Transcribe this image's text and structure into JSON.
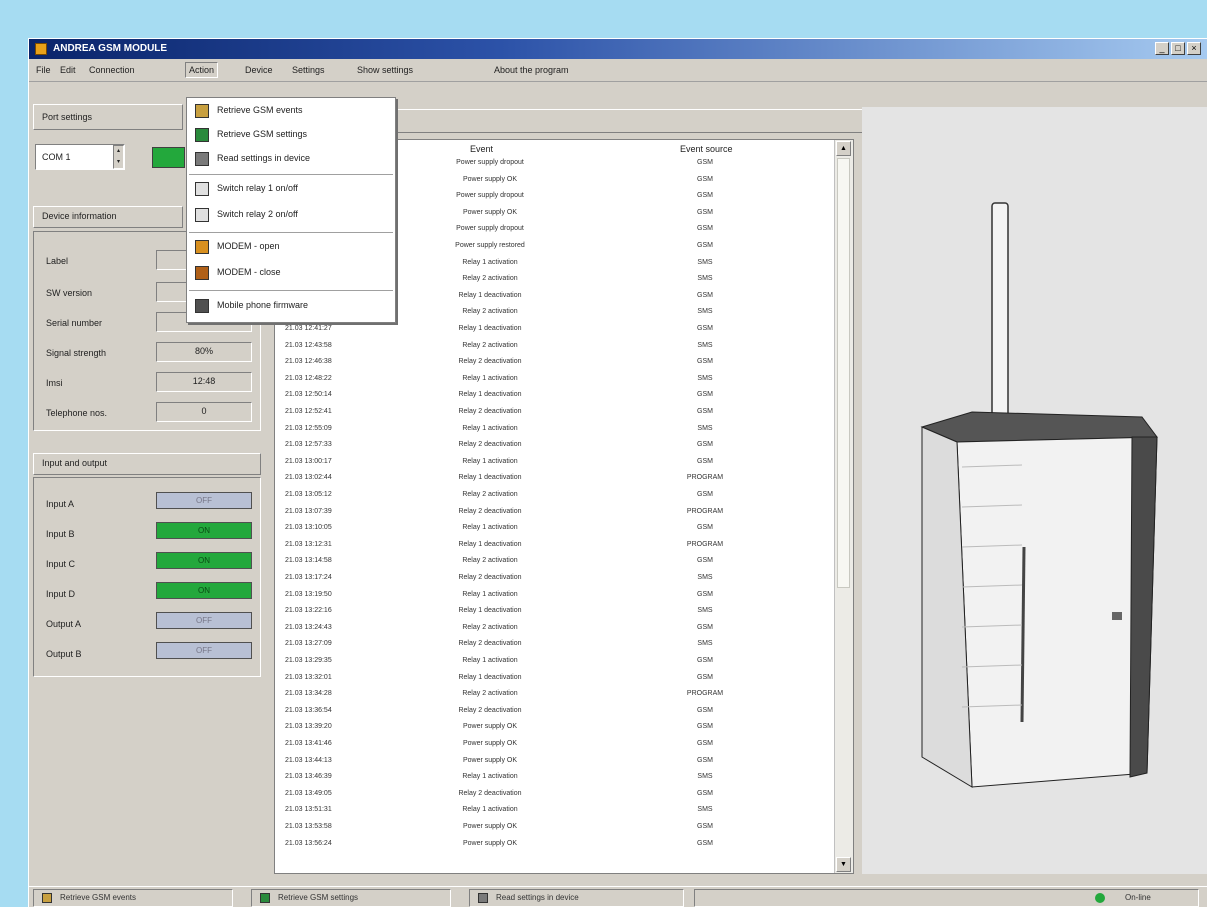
{
  "window": {
    "title": "ANDREA GSM MODULE"
  },
  "menu": [
    {
      "label": "File"
    },
    {
      "label": "Edit"
    },
    {
      "label": "Connection"
    },
    {
      "label": "Action"
    },
    {
      "label": "Device"
    },
    {
      "label": "Settings"
    },
    {
      "label": "Show settings"
    },
    {
      "label": "About the program"
    }
  ],
  "dropdown": {
    "items": [
      {
        "label": "Retrieve GSM events",
        "icon": "download-events-icon",
        "color": "#c8a040"
      },
      {
        "label": "Retrieve GSM settings",
        "icon": "settings-chip-icon",
        "color": "#2a8a3c"
      },
      {
        "label": "Read settings in device",
        "icon": "upload-settings-icon",
        "color": "#7a7a7a"
      },
      {
        "label": "Switch relay 1 on/off",
        "icon": "relay-icon",
        "color": "#e0e0e0"
      },
      {
        "label": "Switch relay 2 on/off",
        "icon": "relay-icon",
        "color": "#e0e0e0"
      },
      {
        "label": "MODEM - open",
        "icon": "modem-open-icon",
        "color": "#d89020"
      },
      {
        "label": "MODEM - close",
        "icon": "modem-close-icon",
        "color": "#b06018"
      },
      {
        "label": "Mobile phone firmware",
        "icon": "firmware-icon",
        "color": "#505050"
      }
    ]
  },
  "left": {
    "port_header": "Port settings",
    "port_value": "COM 1",
    "port_status_color": "#23a83c",
    "info_header": "Device information",
    "info_rows": [
      {
        "label": "Label",
        "value": ""
      },
      {
        "label": "SW version",
        "value": ""
      },
      {
        "label": "Serial number",
        "value": ""
      },
      {
        "label": "Signal strength",
        "value": "80%"
      },
      {
        "label": "Imsi",
        "value": "12:48"
      },
      {
        "label": "Telephone nos.",
        "value": "0"
      }
    ],
    "io_header": "Input and output",
    "io_rows": [
      {
        "label": "Input A",
        "state": "off",
        "text": "OFF"
      },
      {
        "label": "Input B",
        "state": "on",
        "text": "ON"
      },
      {
        "label": "Input C",
        "state": "on",
        "text": "ON"
      },
      {
        "label": "Input D",
        "state": "on",
        "text": "ON"
      },
      {
        "label": "Output A",
        "state": "off",
        "text": "OFF"
      },
      {
        "label": "Output B",
        "state": "off",
        "text": "OFF"
      }
    ]
  },
  "table": {
    "headers": {
      "time": "",
      "event": "Event",
      "source": "Event source"
    },
    "rows": [
      {
        "time": "",
        "event": "Power supply dropout",
        "source": "GSM"
      },
      {
        "time": "",
        "event": "Power supply OK",
        "source": "GSM"
      },
      {
        "time": "",
        "event": "Power supply dropout",
        "source": "GSM"
      },
      {
        "time": "",
        "event": "Power supply OK",
        "source": "GSM"
      },
      {
        "time": "",
        "event": "Power supply dropout",
        "source": "GSM"
      },
      {
        "time": "",
        "event": "Power supply restored",
        "source": "GSM"
      },
      {
        "time": "",
        "event": "Relay 1 activation",
        "source": "SMS"
      },
      {
        "time": "",
        "event": "Relay 2 activation",
        "source": "SMS"
      },
      {
        "time": "",
        "event": "Relay 1 deactivation",
        "source": "GSM"
      },
      {
        "time": "",
        "event": "Relay 2 activation",
        "source": "SMS"
      },
      {
        "time": "21.03 12:41:27",
        "event": "Relay 1 deactivation",
        "source": "GSM"
      },
      {
        "time": "21.03 12:43:58",
        "event": "Relay 2 activation",
        "source": "SMS"
      },
      {
        "time": "21.03 12:46:38",
        "event": "Relay 2 deactivation",
        "source": "GSM"
      },
      {
        "time": "21.03 12:48:22",
        "event": "Relay 1 activation",
        "source": "SMS"
      },
      {
        "time": "21.03 12:50:14",
        "event": "Relay 1 deactivation",
        "source": "GSM"
      },
      {
        "time": "21.03 12:52:41",
        "event": "Relay 2 deactivation",
        "source": "GSM"
      },
      {
        "time": "21.03 12:55:09",
        "event": "Relay 1 activation",
        "source": "SMS"
      },
      {
        "time": "21.03 12:57:33",
        "event": "Relay 2 deactivation",
        "source": "GSM"
      },
      {
        "time": "21.03 13:00:17",
        "event": "Relay 1 activation",
        "source": "GSM"
      },
      {
        "time": "21.03 13:02:44",
        "event": "Relay 1 deactivation",
        "source": "PROGRAM"
      },
      {
        "time": "21.03 13:05:12",
        "event": "Relay 2 activation",
        "source": "GSM"
      },
      {
        "time": "21.03 13:07:39",
        "event": "Relay 2 deactivation",
        "source": "PROGRAM"
      },
      {
        "time": "21.03 13:10:05",
        "event": "Relay 1 activation",
        "source": "GSM"
      },
      {
        "time": "21.03 13:12:31",
        "event": "Relay 1 deactivation",
        "source": "PROGRAM"
      },
      {
        "time": "21.03 13:14:58",
        "event": "Relay 2 activation",
        "source": "GSM"
      },
      {
        "time": "21.03 13:17:24",
        "event": "Relay 2 deactivation",
        "source": "SMS"
      },
      {
        "time": "21.03 13:19:50",
        "event": "Relay 1 activation",
        "source": "GSM"
      },
      {
        "time": "21.03 13:22:16",
        "event": "Relay 1 deactivation",
        "source": "SMS"
      },
      {
        "time": "21.03 13:24:43",
        "event": "Relay 2 activation",
        "source": "GSM"
      },
      {
        "time": "21.03 13:27:09",
        "event": "Relay 2 deactivation",
        "source": "SMS"
      },
      {
        "time": "21.03 13:29:35",
        "event": "Relay 1 activation",
        "source": "GSM"
      },
      {
        "time": "21.03 13:32:01",
        "event": "Relay 1 deactivation",
        "source": "GSM"
      },
      {
        "time": "21.03 13:34:28",
        "event": "Relay 2 activation",
        "source": "PROGRAM"
      },
      {
        "time": "21.03 13:36:54",
        "event": "Relay 2 deactivation",
        "source": "GSM"
      },
      {
        "time": "21.03 13:39:20",
        "event": "Power supply OK",
        "source": "GSM"
      },
      {
        "time": "21.03 13:41:46",
        "event": "Power supply OK",
        "source": "GSM"
      },
      {
        "time": "21.03 13:44:13",
        "event": "Power supply OK",
        "source": "GSM"
      },
      {
        "time": "21.03 13:46:39",
        "event": "Relay 1 activation",
        "source": "SMS"
      },
      {
        "time": "21.03 13:49:05",
        "event": "Relay 2 deactivation",
        "source": "GSM"
      },
      {
        "time": "21.03 13:51:31",
        "event": "Relay 1 activation",
        "source": "SMS"
      },
      {
        "time": "21.03 13:53:58",
        "event": "Power supply OK",
        "source": "GSM"
      },
      {
        "time": "21.03 13:56:24",
        "event": "Power supply OK",
        "source": "GSM"
      }
    ]
  },
  "statusbar": {
    "items": [
      {
        "label": "Retrieve GSM events",
        "icon": "download-events-icon",
        "color": "#c8a040"
      },
      {
        "label": "Retrieve GSM settings",
        "icon": "settings-chip-icon",
        "color": "#2a8a3c"
      },
      {
        "label": "Read settings in device",
        "icon": "upload-settings-icon",
        "color": "#7a7a7a"
      }
    ],
    "status_text": "On-line",
    "status_color": "#23a83c"
  }
}
